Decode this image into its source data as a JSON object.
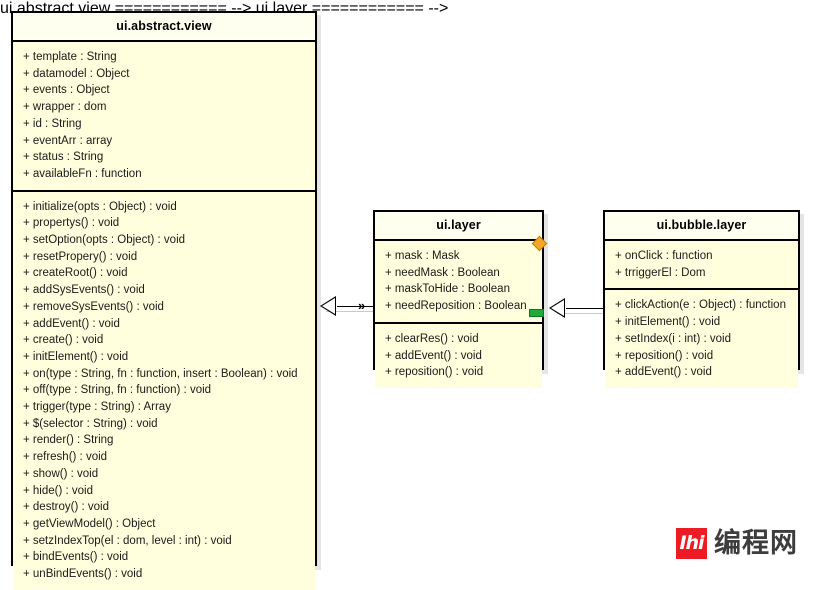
{
  "diagram": {
    "type": "uml-class-diagram",
    "background_color": "#ffffff",
    "class_fill_color": "#ffffdd",
    "class_header_color": "#fffff0",
    "border_color": "#000000"
  },
  "classes": [
    {
      "id": "ui-abstract-view",
      "name": "ui.abstract.view",
      "attributes": [
        "+ template : String",
        "+ datamodel : Object",
        "+ events : Object",
        "+ wrapper : dom",
        "+ id : String",
        "+ eventArr : array",
        "+ status : String",
        "+ availableFn : function"
      ],
      "methods": [
        "+ initialize(opts : Object) : void",
        "+ propertys() : void",
        "+ setOption(opts : Object) : void",
        "+ resetPropery() : void",
        "+ createRoot() : void",
        "+ addSysEvents() : void",
        "+ removeSysEvents() : void",
        "+ addEvent() : void",
        "+ create() : void",
        "+ initElement() : void",
        "+ on(type : String, fn : function, insert : Boolean) : void",
        "+ off(type : String, fn : function) : void",
        "+ trigger(type : String) : Array",
        "+ $(selector : String) : void",
        "+ render() : String",
        "+ refresh() : void",
        "+ show() : void",
        "+ hide() : void",
        "+ destroy() : void",
        "+ getViewModel() : Object",
        "+ setzIndexTop(el : dom, level : int) : void",
        "+ bindEvents() : void",
        "+ unBindEvents() : void"
      ]
    },
    {
      "id": "ui-layer",
      "name": "ui.layer",
      "attributes": [
        "+ mask : Mask",
        "+ needMask : Boolean",
        "+ maskToHide : Boolean",
        "+ needReposition : Boolean"
      ],
      "methods": [
        "+ clearRes() : void",
        "+ addEvent() : void",
        "+ reposition() : void"
      ],
      "markers": {
        "diamond_color": "#f5a623",
        "square_color": "#1faa39"
      }
    },
    {
      "id": "ui-bubble-layer",
      "name": "ui.bubble.layer",
      "attributes": [
        "+ onClick : function",
        "+ trriggerEl : Dom"
      ],
      "methods": [
        "+ clickAction(e : Object) : function",
        "+ initElement() : void",
        "+ setIndex(i : int) : void",
        "+ reposition() : void",
        "+ addEvent() : void"
      ]
    }
  ],
  "connectors": [
    {
      "id": "layer-extends-view",
      "from": "ui.layer",
      "to": "ui.abstract.view",
      "kind": "generalization",
      "arrow": "hollow-triangle"
    },
    {
      "id": "bubble-extends-layer",
      "from": "ui.bubble.layer",
      "to": "ui.layer",
      "kind": "generalization",
      "arrow": "hollow-triangle"
    }
  ],
  "watermark": {
    "mark_glyph": "Ihi",
    "text": "编程网",
    "mark_color": "#ed1c24",
    "text_color": "#3d3d3d"
  }
}
